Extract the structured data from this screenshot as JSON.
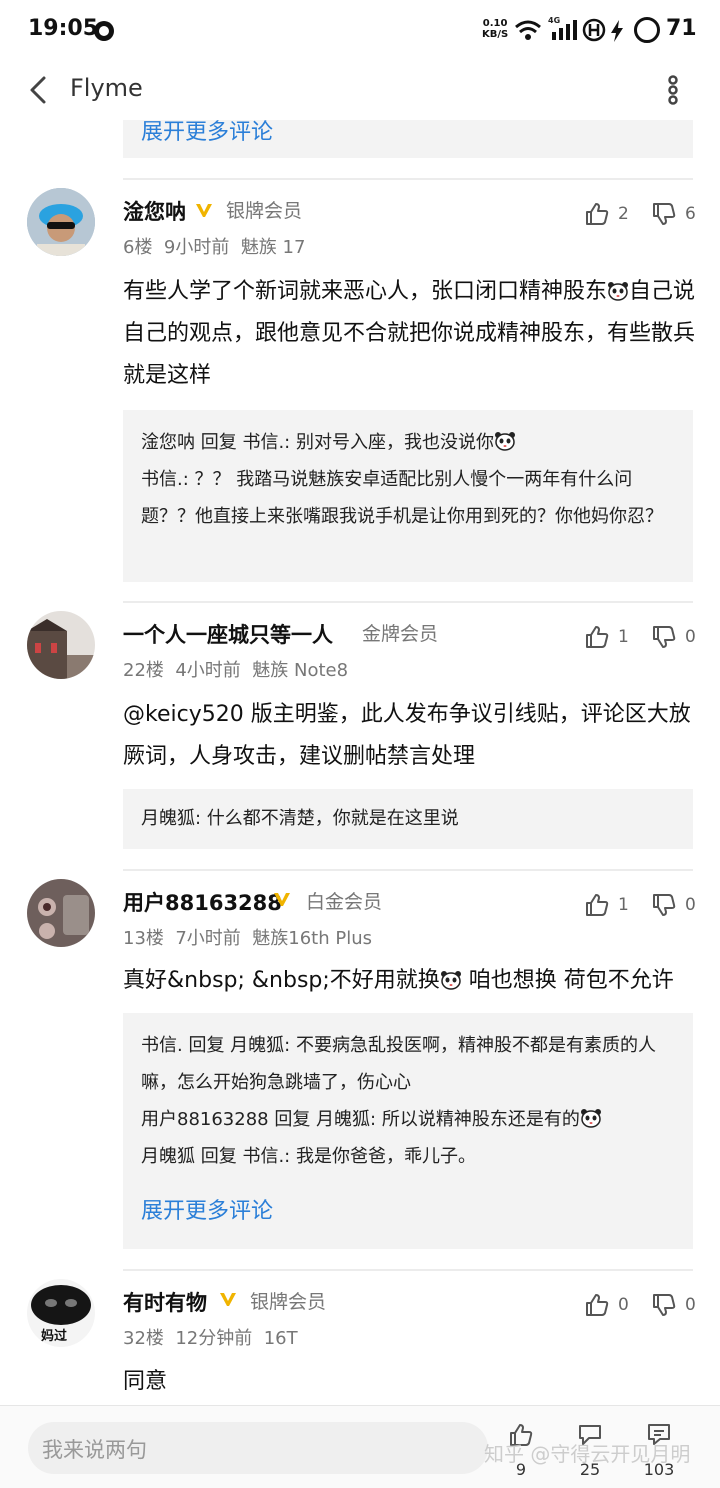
{
  "status_bar": {
    "time": "19:05",
    "net_speed_value": "0.10",
    "net_speed_unit": "KB/S",
    "net_type": "4G",
    "battery": "71"
  },
  "nav": {
    "title": "Flyme"
  },
  "prev_thread": {
    "expand_label": "展开更多评论"
  },
  "comments": [
    {
      "username": "淦您呐",
      "member_level": "银牌会员",
      "floor": "6楼",
      "time": "9小时前",
      "device": "魅族 17",
      "likes": "2",
      "dislikes": "6",
      "content_a": "有些人学了个新词就来恶心人，张口闭口精神股东",
      "content_b": "自己说自己的观点，跟他意见不合就把你说成精神股东，有些散兵就是这样",
      "replies": [
        {
          "text": "淦您呐 回复 书信.: 别对号入座，我也没说你"
        },
        {
          "text": "书信.: ？？ 我踏马说魅族安卓适配比别人慢个一两年有什么问题？？他直接上来张嘴跟我说手机是让你用到死的？你他妈你忍？"
        }
      ]
    },
    {
      "username": "一个人一座城只等一人",
      "member_level": "金牌会员",
      "floor": "22楼",
      "time": "4小时前",
      "device": "魅族 Note8",
      "likes": "1",
      "dislikes": "0",
      "content": "@keicy520 版主明鉴，此人发布争议引线贴，评论区大放厥词，人身攻击，建议删帖禁言处理",
      "replies": [
        {
          "text": "月魄狐: 什么都不清楚，你就是在这里说"
        }
      ]
    },
    {
      "username": "用户88163288",
      "member_level": "白金会员",
      "floor": "13楼",
      "time": "7小时前",
      "device": "魅族16th Plus",
      "likes": "1",
      "dislikes": "0",
      "content_a": "真好&nbsp; &nbsp;不好用就换",
      "content_b": " 咱也想换  荷包不允许",
      "replies": [
        {
          "text": "书信. 回复 月魄狐: 不要病急乱投医啊，精神股不都是有素质的人嘛，怎么开始狗急跳墙了，伤心心"
        },
        {
          "text": "用户88163288 回复 月魄狐: 所以说精神股东还是有的"
        },
        {
          "text": "月魄狐 回复 书信.: 我是你爸爸，乖儿子。"
        }
      ],
      "expand_label": "展开更多评论"
    },
    {
      "username": "有时有物",
      "member_level": "银牌会员",
      "floor": "32楼",
      "time": "12分钟前",
      "device": "16T",
      "likes": "0",
      "dislikes": "0",
      "content": "同意",
      "avatar_text": "妈过"
    }
  ],
  "bottom_bar": {
    "input_placeholder": "我来说两句",
    "like_count": "9",
    "fav_count": "25",
    "comment_count": "103",
    "watermark": "知乎 @守得云开见月明"
  },
  "colors": {
    "link": "#2b7fd8",
    "vip_badge": "#f0b400",
    "reply_bg": "#f3f3f3"
  },
  "icons": {
    "back": "chevron-left-icon",
    "more": "more-vertical-icon",
    "like": "thumbs-up-icon",
    "dislike": "thumbs-down-icon",
    "comment": "comment-icon",
    "favorite": "favorite-icon",
    "emoji": "panda-emoji-icon"
  }
}
